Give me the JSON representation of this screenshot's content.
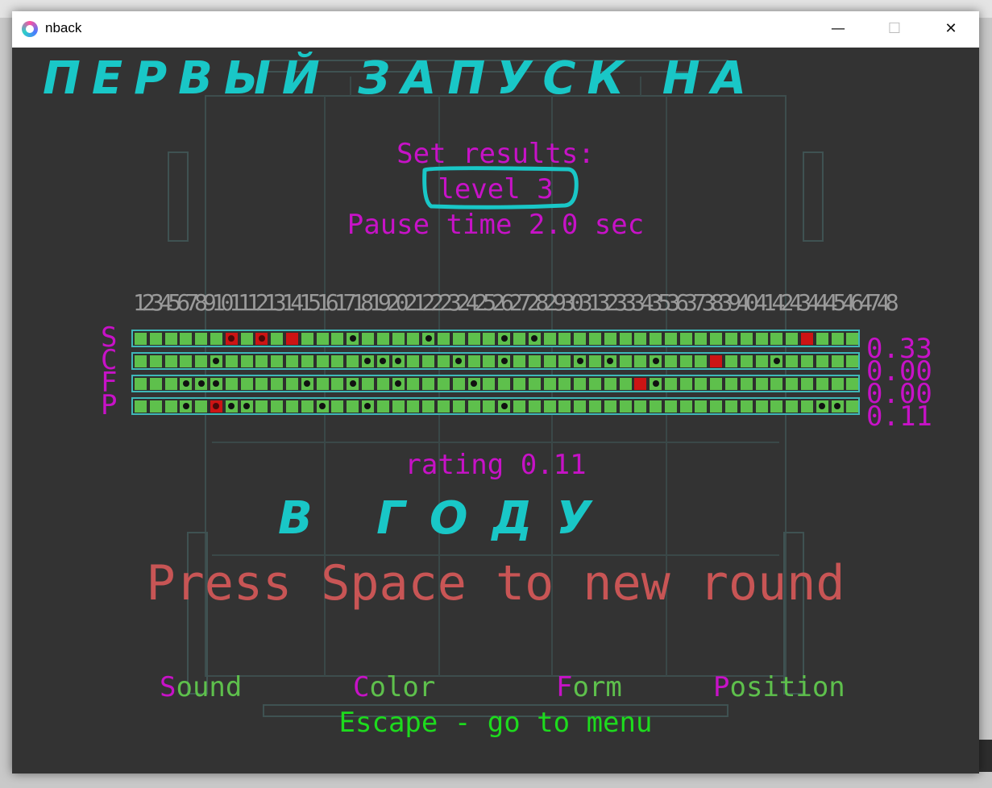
{
  "window": {
    "title": "nback",
    "controls": {
      "minimize": "—",
      "maximize": "☐",
      "close": "✕"
    }
  },
  "results": {
    "heading": "Set results:",
    "level": "level 3",
    "pause": "Pause time 2.0 sec",
    "rating": "rating 0.11",
    "press_space": "Press Space to new round",
    "escape": "Escape - go to menu"
  },
  "numbers_row": "123456789101112131415161718192021222324252627282930313233343536373839404142434445464748",
  "rows": [
    {
      "letter": "S",
      "score": "0.33",
      "cells": [
        0,
        0,
        0,
        0,
        0,
        0,
        3,
        0,
        3,
        0,
        1,
        0,
        0,
        0,
        2,
        0,
        0,
        0,
        0,
        2,
        0,
        0,
        0,
        0,
        2,
        0,
        2,
        0,
        0,
        0,
        0,
        0,
        0,
        0,
        0,
        0,
        0,
        0,
        0,
        0,
        0,
        0,
        0,
        0,
        1,
        0,
        0,
        0
      ]
    },
    {
      "letter": "C",
      "score": "0.00",
      "cells": [
        0,
        0,
        0,
        0,
        0,
        2,
        0,
        0,
        0,
        0,
        0,
        0,
        0,
        0,
        0,
        2,
        2,
        2,
        0,
        0,
        0,
        2,
        0,
        0,
        2,
        0,
        0,
        0,
        0,
        2,
        0,
        2,
        0,
        0,
        2,
        0,
        0,
        0,
        1,
        0,
        0,
        0,
        2,
        0,
        0,
        0,
        0,
        0
      ]
    },
    {
      "letter": "F",
      "score": "0.00",
      "cells": [
        0,
        0,
        0,
        2,
        2,
        2,
        0,
        0,
        0,
        0,
        0,
        2,
        0,
        0,
        2,
        0,
        0,
        2,
        0,
        0,
        0,
        0,
        2,
        0,
        0,
        0,
        0,
        0,
        0,
        0,
        0,
        0,
        0,
        1,
        2,
        0,
        0,
        0,
        0,
        0,
        0,
        0,
        0,
        0,
        0,
        0,
        0,
        0
      ]
    },
    {
      "letter": "P",
      "score": "0.11",
      "cells": [
        0,
        0,
        0,
        2,
        0,
        3,
        2,
        2,
        0,
        0,
        0,
        0,
        2,
        0,
        0,
        2,
        0,
        0,
        0,
        0,
        0,
        0,
        0,
        0,
        2,
        0,
        0,
        0,
        0,
        0,
        0,
        0,
        0,
        0,
        0,
        0,
        0,
        0,
        0,
        0,
        0,
        0,
        0,
        0,
        0,
        2,
        2,
        0
      ]
    }
  ],
  "modalities": [
    {
      "first": "S",
      "rest": "ound"
    },
    {
      "first": "C",
      "rest": "olor"
    },
    {
      "first": "F",
      "rest": "orm"
    },
    {
      "first": "P",
      "rest": "osition"
    }
  ],
  "annotations": {
    "top": "ПЕРВЫЙ ЗАПУСК НА",
    "middle": "В ГОДУ"
  },
  "colors": {
    "background": "#333333",
    "magenta": "#c712c7",
    "cell_green": "#5ec04c",
    "cell_red": "#cc1414",
    "border_cyan": "#3fb8b8",
    "press_space": "#c85555",
    "menu_green": "#1ddb1d",
    "handwriting": "#19c7c7"
  }
}
